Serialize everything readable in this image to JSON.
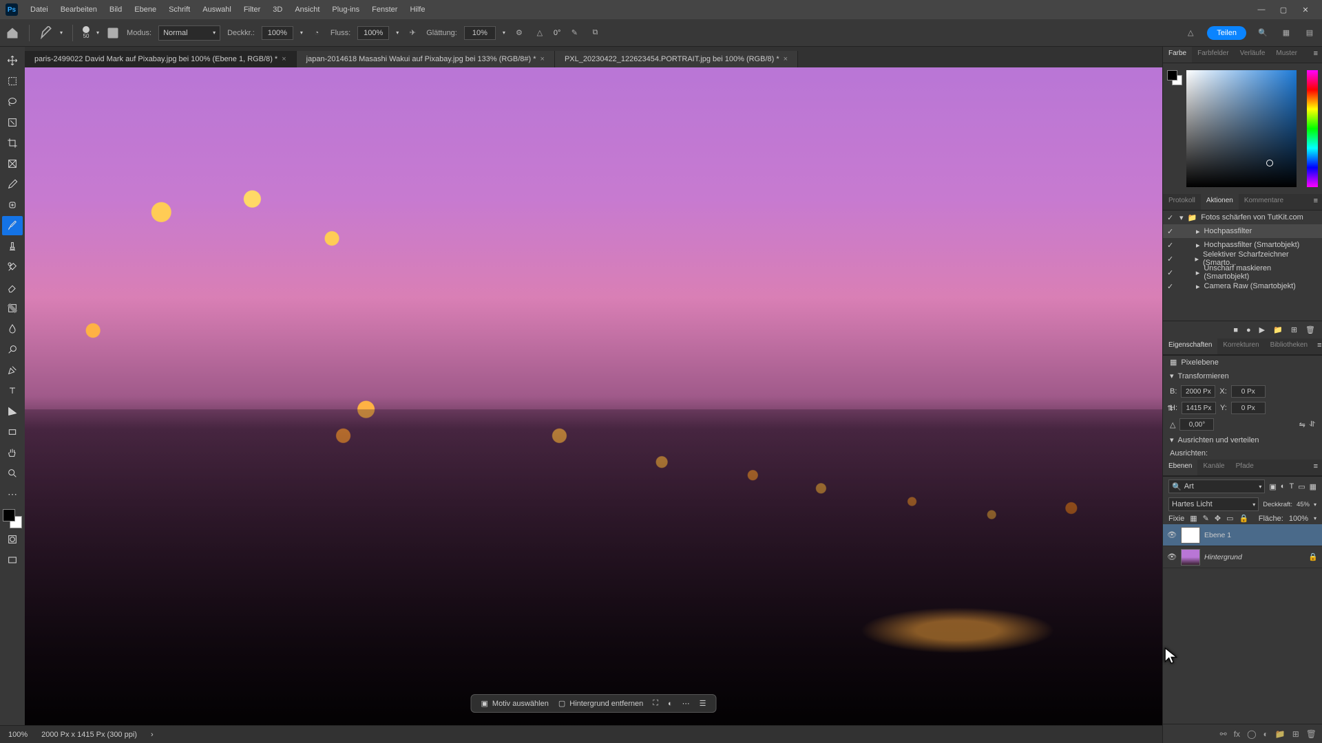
{
  "menu": {
    "items": [
      "Datei",
      "Bearbeiten",
      "Bild",
      "Ebene",
      "Schrift",
      "Auswahl",
      "Filter",
      "3D",
      "Ansicht",
      "Plug-ins",
      "Fenster",
      "Hilfe"
    ]
  },
  "optbar": {
    "mode_label": "Modus:",
    "mode_value": "Normal",
    "opacity_label": "Deckkr.:",
    "opacity_value": "100%",
    "flow_label": "Fluss:",
    "flow_value": "100%",
    "smooth_label": "Glättung:",
    "smooth_value": "10%",
    "angle_value": "0°",
    "brush_size": "50",
    "share": "Teilen"
  },
  "tabs": [
    {
      "label": "paris-2499022  David Mark auf Pixabay.jpg bei 100% (Ebene 1, RGB/8) *",
      "active": true
    },
    {
      "label": "japan-2014618 Masashi Wakui auf Pixabay.jpg bei 133% (RGB/8#) *",
      "active": false
    },
    {
      "label": "PXL_20230422_122623454.PORTRAIT.jpg bei 100% (RGB/8) *",
      "active": false
    }
  ],
  "ctxbar": {
    "select_subject": "Motiv auswählen",
    "remove_bg": "Hintergrund entfernen"
  },
  "status": {
    "zoom": "100%",
    "info": "2000 Px x 1415 Px (300 ppi)"
  },
  "panels": {
    "color_tabs": [
      "Farbe",
      "Farbfelder",
      "Verläufe",
      "Muster"
    ],
    "history_tabs": [
      "Protokoll",
      "Aktionen",
      "Kommentare"
    ],
    "actions_folder": "Fotos schärfen von TutKit.com",
    "actions": [
      "Hochpassfilter",
      "Hochpassfilter (Smartobjekt)",
      "Selektiver Scharfzeichner (Smarto...",
      "Unscharf maskieren (Smartobjekt)",
      "Camera Raw (Smartobjekt)"
    ],
    "props_tabs": [
      "Eigenschaften",
      "Korrekturen",
      "Bibliotheken"
    ],
    "props_title": "Pixelebene",
    "transform": "Transformieren",
    "w_label": "B:",
    "w_val": "2000 Px",
    "x_label": "X:",
    "x_val": "0 Px",
    "h_label": "H:",
    "h_val": "1415 Px",
    "y_label": "Y:",
    "y_val": "0 Px",
    "angle_val": "0,00°",
    "align": "Ausrichten und verteilen",
    "align_sub": "Ausrichten:",
    "layer_tabs": [
      "Ebenen",
      "Kanäle",
      "Pfade"
    ],
    "layer_search": "Art",
    "blend": "Hartes Licht",
    "opacity_label": "Deckkraft:",
    "opacity": "45%",
    "lock_label": "Fixie",
    "fill_label": "Fläche:",
    "fill": "100%",
    "layers": [
      {
        "name": "Ebene 1",
        "sel": true,
        "thumb": "plain"
      },
      {
        "name": "Hintergrund",
        "sel": false,
        "thumb": "img",
        "locked": true
      }
    ]
  }
}
